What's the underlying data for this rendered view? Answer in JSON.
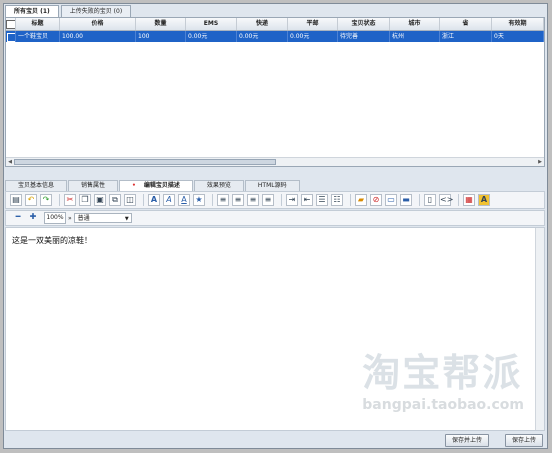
{
  "top_tabs": [
    "所有宝贝 (1)",
    "上传失败的宝贝 (0)"
  ],
  "grid": {
    "columns": [
      "标题",
      "价格",
      "数量",
      "EMS",
      "快递",
      "平邮",
      "宝贝状态",
      "城市",
      "省",
      "有效期"
    ],
    "rows": [
      [
        "一个鞋宝贝",
        "100.00",
        "100",
        "0.00元",
        "0.00元",
        "0.00元",
        "待完善",
        "杭州",
        "浙江",
        "0天"
      ]
    ]
  },
  "editor_tabs": [
    "宝贝基本信息",
    "销售属性",
    "编辑宝贝描述",
    "效果预览",
    "HTML源码"
  ],
  "toolbar2": {
    "zoom": "100%",
    "format": "普通"
  },
  "editor": {
    "content": "这是一双美丽的凉鞋！"
  },
  "bottom": {
    "btn_left": "保存并上传",
    "btn_right": "保存上传"
  },
  "watermark": {
    "big": "淘宝帮派",
    "small": "bangpai.taobao.com"
  },
  "colors": {
    "selected_row": "#1f63c7",
    "accent": "#d33333"
  }
}
